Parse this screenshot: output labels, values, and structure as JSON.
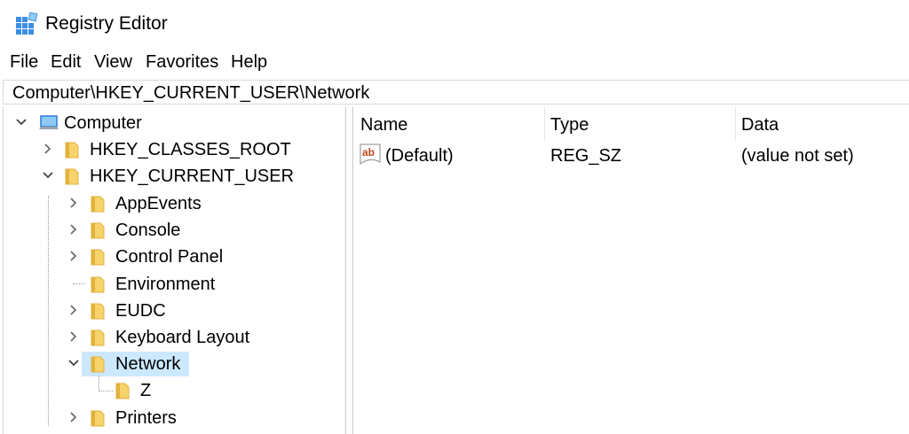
{
  "window": {
    "title": "Registry Editor"
  },
  "menu": [
    "File",
    "Edit",
    "View",
    "Favorites",
    "Help"
  ],
  "address": "Computer\\HKEY_CURRENT_USER\\Network",
  "tree": {
    "root": "Computer",
    "hives": [
      "HKEY_CLASSES_ROOT",
      "HKEY_CURRENT_USER"
    ],
    "children": [
      "AppEvents",
      "Console",
      "Control Panel",
      "Environment",
      "EUDC",
      "Keyboard Layout",
      "Network",
      "Printers"
    ],
    "network_child": "Z",
    "selected": "Network"
  },
  "list": {
    "columns": [
      "Name",
      "Type",
      "Data"
    ],
    "rows": [
      {
        "name": "(Default)",
        "type": "REG_SZ",
        "data": "(value not set)",
        "icon": "string-value-icon"
      }
    ]
  },
  "colors": {
    "selection": "#cce8ff",
    "folder": "#f6d36b",
    "folder_dark": "#e2b23c",
    "accent": "#2f7bd6"
  }
}
